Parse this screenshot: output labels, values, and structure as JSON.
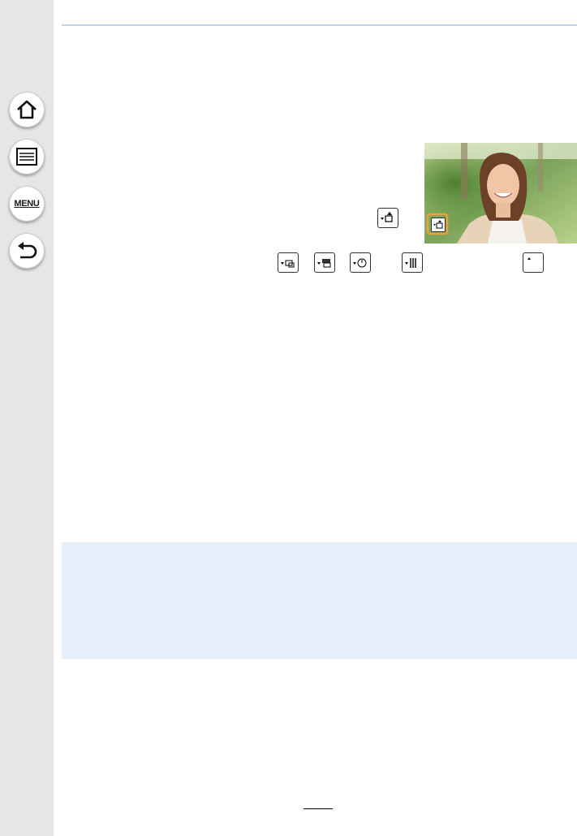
{
  "sidebar": {
    "items": [
      {
        "name": "home",
        "icon": "home-icon"
      },
      {
        "name": "contents",
        "icon": "list-icon"
      },
      {
        "name": "menu",
        "icon": "menu-icon",
        "label": "MENU"
      },
      {
        "name": "back",
        "icon": "back-arrow-icon"
      }
    ]
  },
  "photo": {
    "subject": "woman-portrait",
    "overlay_icon": "one-push-ae-icon"
  },
  "inline_icons": [
    "one-push-ae-icon",
    "burst-icon",
    "auto-bracket-icon",
    "self-timer-icon",
    "multi-exposure-icon",
    "single-icon"
  ],
  "colors": {
    "sidebar": "#e6e6e6",
    "rule": "#c9d1ea",
    "note_box": "#e8f0fb",
    "highlight": "#e8a13c"
  }
}
